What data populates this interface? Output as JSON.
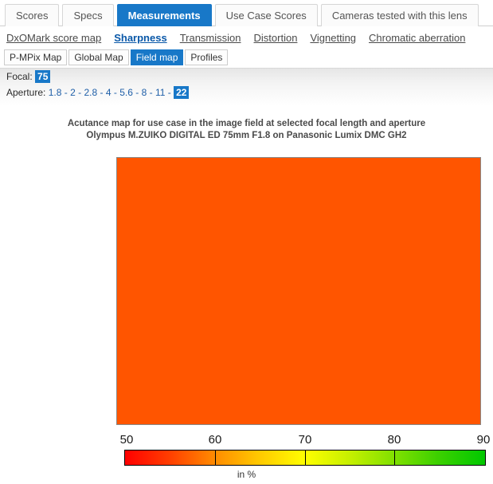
{
  "primary_tabs": [
    {
      "label": "Scores",
      "active": false
    },
    {
      "label": "Specs",
      "active": false
    },
    {
      "label": "Measurements",
      "active": true
    },
    {
      "label": "Use Case Scores",
      "active": false
    },
    {
      "label": "Cameras tested with this lens",
      "active": false
    }
  ],
  "secondary_nav": [
    {
      "label": "DxOMark score map",
      "active": false
    },
    {
      "label": "Sharpness",
      "active": true
    },
    {
      "label": "Transmission",
      "active": false
    },
    {
      "label": "Distortion",
      "active": false
    },
    {
      "label": "Vignetting",
      "active": false
    },
    {
      "label": "Chromatic aberration",
      "active": false
    }
  ],
  "view_tabs": [
    {
      "label": "P-MPix Map",
      "active": false
    },
    {
      "label": "Global Map",
      "active": false
    },
    {
      "label": "Field map",
      "active": true
    },
    {
      "label": "Profiles",
      "active": false
    }
  ],
  "parameters": {
    "focal": {
      "label": "Focal:",
      "values": [
        {
          "value": "75",
          "selected": true
        }
      ]
    },
    "aperture": {
      "label": "Aperture:",
      "separator": "-",
      "values": [
        {
          "value": "1.8",
          "selected": false
        },
        {
          "value": "2",
          "selected": false
        },
        {
          "value": "2.8",
          "selected": false
        },
        {
          "value": "4",
          "selected": false
        },
        {
          "value": "5.6",
          "selected": false
        },
        {
          "value": "8",
          "selected": false
        },
        {
          "value": "11",
          "selected": false
        },
        {
          "value": "22",
          "selected": true
        }
      ]
    }
  },
  "chart_data": {
    "type": "heatmap",
    "title": "Acutance map for use case in the image field at selected focal length and aperture",
    "subtitle": "Olympus M.ZUIKO DIGITAL ED 75mm F1.8 on Panasonic Lumix DMC GH2",
    "xlabel": "",
    "ylabel": "",
    "unit_label": "in %",
    "value_range": [
      50,
      90
    ],
    "tick_labels": [
      "50",
      "60",
      "70",
      "80",
      "90"
    ],
    "tick_values": [
      50,
      60,
      70,
      80,
      90
    ],
    "grid": false,
    "legend_position": "bottom",
    "uniform_value": 58,
    "uniform_color": "#ff5500",
    "field_description": "Entire image field renders a single uniform acutance value rendered as solid orange, corresponding to approximately 58% on the 50-90% scale.",
    "colorscale": [
      {
        "stop": 50,
        "color": "#ff0000"
      },
      {
        "stop": 60,
        "color": "#ff8c00"
      },
      {
        "stop": 70,
        "color": "#ffff00"
      },
      {
        "stop": 80,
        "color": "#7fe000"
      },
      {
        "stop": 90,
        "color": "#00c800"
      }
    ]
  }
}
